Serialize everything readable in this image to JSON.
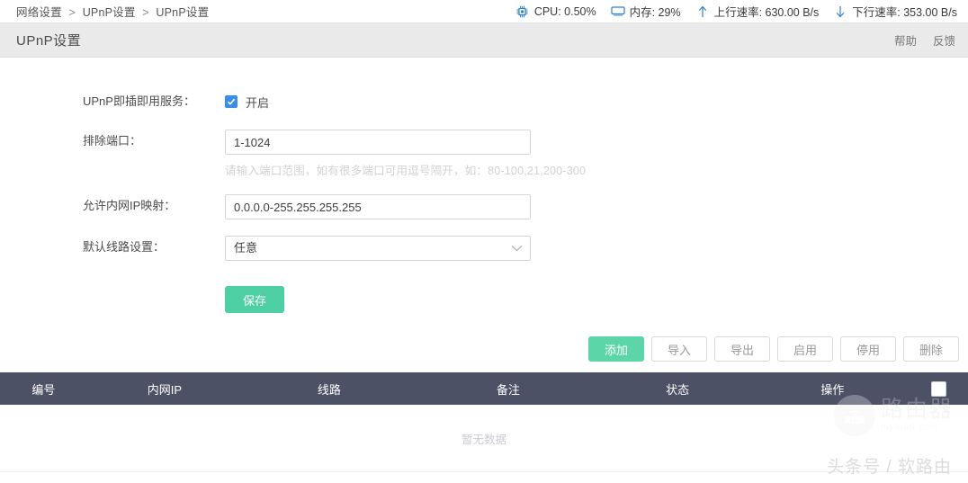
{
  "breadcrumb": {
    "items": [
      "网络设置",
      "UPnP设置",
      "UPnP设置"
    ],
    "separator": ">"
  },
  "status": {
    "cpu": {
      "icon": "cpu-chip-icon",
      "label": "CPU: 0.50%"
    },
    "memory": {
      "icon": "monitor-icon",
      "label": "内存: 29%"
    },
    "upload": {
      "icon": "arrow-up-icon",
      "label": "上行速率: 630.00 B/s"
    },
    "download": {
      "icon": "arrow-down-icon",
      "label": "下行速率: 353.00 B/s"
    }
  },
  "header": {
    "title": "UPnP设置",
    "help_label": "帮助",
    "feedback_label": "反馈"
  },
  "form": {
    "service": {
      "label": "UPnP即插即用服务：",
      "checked": true,
      "checkbox_label": "开启",
      "accent": "#3a8ee6"
    },
    "exclude_ports": {
      "label": "排除端口：",
      "value": "1-1024",
      "placeholder": "",
      "hint": "请输入端口范围，如有很多端口可用逗号隔开，如：80-100,21,200-300"
    },
    "lan_ip_map": {
      "label": "允许内网IP映射：",
      "value": "0.0.0.0-255.255.255.255",
      "placeholder": ""
    },
    "default_line": {
      "label": "默认线路设置：",
      "value": "任意"
    },
    "save_label": "保存",
    "save_color": "#4fcfa4"
  },
  "actions": [
    {
      "label": "添加",
      "primary": true
    },
    {
      "label": "导入",
      "primary": false
    },
    {
      "label": "导出",
      "primary": false
    },
    {
      "label": "启用",
      "primary": false
    },
    {
      "label": "停用",
      "primary": false
    },
    {
      "label": "删除",
      "primary": false
    }
  ],
  "table": {
    "headers": {
      "num": "编号",
      "ip": "内网IP",
      "line": "线路",
      "note": "备注",
      "state": "状态",
      "op": "操作"
    },
    "select_all_checked": false,
    "empty_text": "暂无数据",
    "header_bg": "#4d5165"
  },
  "watermark": {
    "brand": "路由器",
    "site": "luyouqi.com",
    "footer": "头条号 / 软路由"
  }
}
